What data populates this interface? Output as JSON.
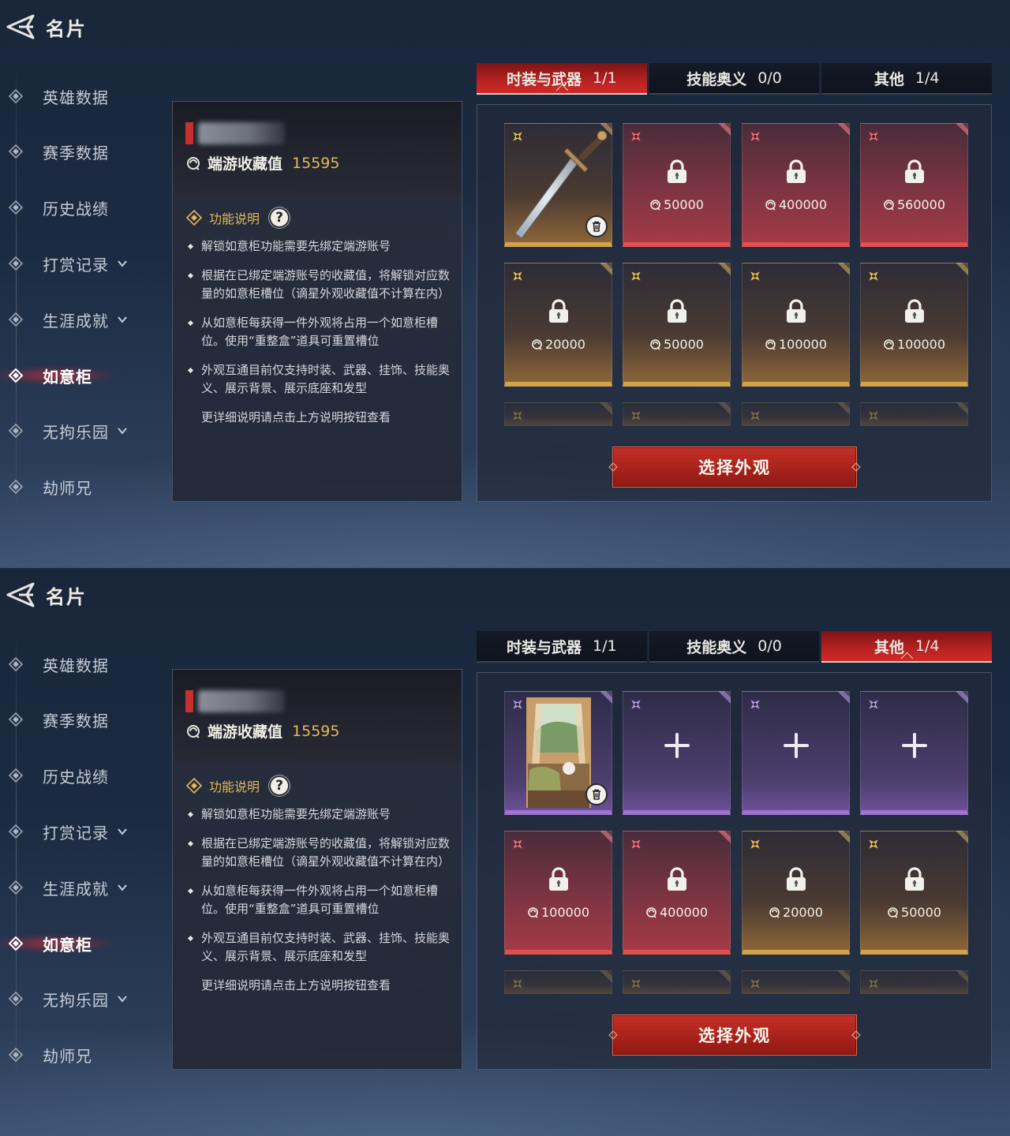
{
  "colors": {
    "accent_red": "#c8302f",
    "gold_text": "#e3b95b",
    "card_red": "#a33a46",
    "card_gold": "#8a6438",
    "card_purple": "#6b4f95"
  },
  "screens": [
    {
      "header": {
        "title": "名片",
        "back_icon": "back-arrow-icon"
      },
      "sidebar": {
        "items": [
          {
            "label": "英雄数据"
          },
          {
            "label": "赛季数据"
          },
          {
            "label": "历史战绩"
          },
          {
            "label": "打赏记录"
          },
          {
            "label": "生涯成就"
          },
          {
            "label": "如意柜"
          },
          {
            "label": "无拘乐园"
          },
          {
            "label": "劫师兄"
          }
        ],
        "active_label": "如意柜"
      },
      "info": {
        "collection_label": "端游收藏值",
        "collection_value": "15595",
        "func_title": "功能说明",
        "help_label": "?",
        "bullets": [
          "解锁如意柜功能需要先绑定端游账号",
          "根据在已绑定端游账号的收藏值，将解锁对应数量的如意柜槽位（谪星外观收藏值不计算在内）",
          "从如意柜每获得一件外观将占用一个如意柜槽位。使用“重整盒”道具可重置槽位",
          "外观互通目前仅支持时装、武器、挂饰、技能奥义、展示背景、展示底座和发型"
        ],
        "footer_note": "更详细说明请点击上方说明按钮查看"
      },
      "tabs": [
        {
          "label": "时装与武器",
          "count": "1/1"
        },
        {
          "label": "技能奥义",
          "count": "0/0"
        },
        {
          "label": "其他",
          "count": "1/4"
        }
      ],
      "active_tab": "时装与武器",
      "slots": [
        {
          "type": "item",
          "rarity": "gold",
          "content": "sword",
          "icon": "sword-icon"
        },
        {
          "type": "locked",
          "rarity": "red",
          "price": "50000"
        },
        {
          "type": "locked",
          "rarity": "red",
          "price": "400000"
        },
        {
          "type": "locked",
          "rarity": "red",
          "price": "560000"
        },
        {
          "type": "locked",
          "rarity": "gold",
          "price": "20000"
        },
        {
          "type": "locked",
          "rarity": "gold",
          "price": "50000"
        },
        {
          "type": "locked",
          "rarity": "gold",
          "price": "100000"
        },
        {
          "type": "locked",
          "rarity": "gold",
          "price": "100000"
        }
      ],
      "select_button": "选择外观"
    },
    {
      "header": {
        "title": "名片",
        "back_icon": "back-arrow-icon"
      },
      "sidebar": {
        "items": [
          {
            "label": "英雄数据"
          },
          {
            "label": "赛季数据"
          },
          {
            "label": "历史战绩"
          },
          {
            "label": "打赏记录"
          },
          {
            "label": "生涯成就"
          },
          {
            "label": "如意柜"
          },
          {
            "label": "无拘乐园"
          },
          {
            "label": "劫师兄"
          }
        ],
        "active_label": "如意柜"
      },
      "info": {
        "collection_label": "端游收藏值",
        "collection_value": "15595",
        "func_title": "功能说明",
        "help_label": "?",
        "bullets": [
          "解锁如意柜功能需要先绑定端游账号",
          "根据在已绑定端游账号的收藏值，将解锁对应数量的如意柜槽位（谪星外观收藏值不计算在内）",
          "从如意柜每获得一件外观将占用一个如意柜槽位。使用“重整盒”道具可重置槽位",
          "外观互通目前仅支持时装、武器、挂饰、技能奥义、展示背景、展示底座和发型"
        ],
        "footer_note": "更详细说明请点击上方说明按钮查看"
      },
      "tabs": [
        {
          "label": "时装与武器",
          "count": "1/1"
        },
        {
          "label": "技能奥义",
          "count": "0/0"
        },
        {
          "label": "其他",
          "count": "1/4"
        }
      ],
      "active_tab": "其他",
      "slots": [
        {
          "type": "item",
          "rarity": "purple",
          "content": "room-background",
          "icon": "background-image-icon"
        },
        {
          "type": "empty",
          "rarity": "purple",
          "icon": "plus-icon"
        },
        {
          "type": "empty",
          "rarity": "purple",
          "icon": "plus-icon"
        },
        {
          "type": "empty",
          "rarity": "purple",
          "icon": "plus-icon"
        },
        {
          "type": "locked",
          "rarity": "red",
          "price": "100000"
        },
        {
          "type": "locked",
          "rarity": "red",
          "price": "400000"
        },
        {
          "type": "locked",
          "rarity": "gold",
          "price": "20000"
        },
        {
          "type": "locked",
          "rarity": "gold",
          "price": "50000"
        }
      ],
      "select_button": "选择外观"
    }
  ]
}
